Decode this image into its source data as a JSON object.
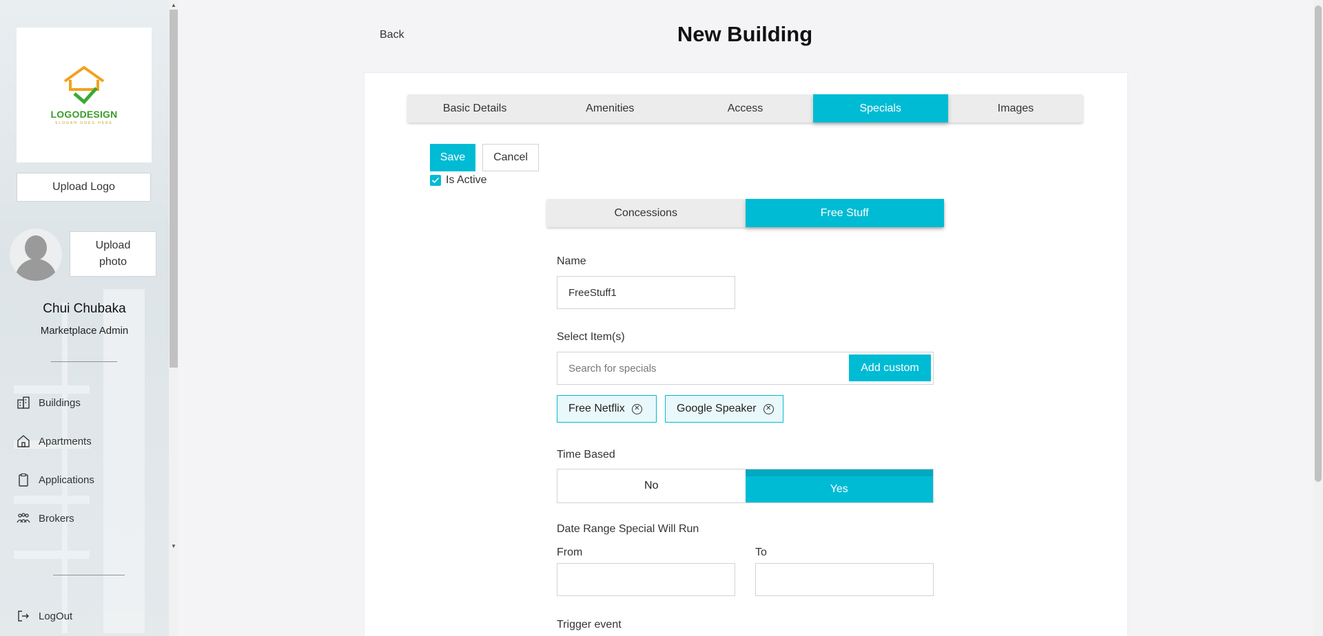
{
  "sidebar": {
    "logo": {
      "text": "LOGODESIGN",
      "sub": "SLOGAN GOES HERE"
    },
    "upload_logo": "Upload Logo",
    "upload_photo": "Upload photo",
    "user_name": "Chui Chubaka",
    "user_role": "Marketplace Admin",
    "nav": [
      {
        "label": "Buildings",
        "icon": "building-icon"
      },
      {
        "label": "Apartments",
        "icon": "home-icon"
      },
      {
        "label": "Applications",
        "icon": "clipboard-icon"
      },
      {
        "label": "Brokers",
        "icon": "users-icon"
      }
    ],
    "logout": "LogOut"
  },
  "header": {
    "back": "Back",
    "title": "New Building"
  },
  "tabs": [
    {
      "label": "Basic Details",
      "active": false
    },
    {
      "label": "Amenities",
      "active": false
    },
    {
      "label": "Access",
      "active": false
    },
    {
      "label": "Specials",
      "active": true
    },
    {
      "label": "Images",
      "active": false
    }
  ],
  "actions": {
    "save": "Save",
    "cancel": "Cancel",
    "is_active_label": "Is Active",
    "is_active": true
  },
  "subtabs": [
    {
      "label": "Concessions",
      "active": false
    },
    {
      "label": "Free Stuff",
      "active": true
    }
  ],
  "form": {
    "name_label": "Name",
    "name_value": "FreeStuff1",
    "select_label": "Select Item(s)",
    "search_placeholder": "Search for specials",
    "add_custom": "Add custom",
    "chips": [
      "Free Netflix",
      "Google Speaker"
    ],
    "time_based_label": "Time Based",
    "time_based_no": "No",
    "time_based_yes": "Yes",
    "time_based_value": "Yes",
    "date_range_label": "Date Range Special Will Run",
    "from_label": "From",
    "to_label": "To",
    "from_value": "",
    "to_value": "",
    "trigger_label": "Trigger event"
  },
  "colors": {
    "accent": "#00bbd4"
  }
}
